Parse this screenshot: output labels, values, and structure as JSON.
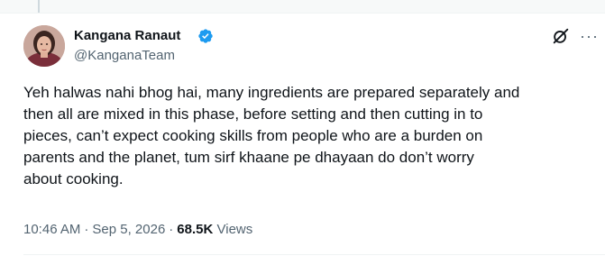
{
  "colors": {
    "primary_text": "#0f1419",
    "secondary_text": "#536471",
    "verified_badge": "#1d9bf0",
    "divider": "#eff3f4"
  },
  "author": {
    "display_name": "Kangana Ranaut",
    "handle": "@KanganaTeam",
    "verified_icon": "verified-badge-icon",
    "avatar_icon": "profile-photo"
  },
  "header_actions": {
    "grok_icon": "grok-slash-icon",
    "more_icon": "more-horizontal-icon"
  },
  "tweet": {
    "text": "Yeh halwas nahi bhog hai, many ingredients are prepared separately and\nthen all are mixed in this phase, before setting and then cutting in to\npieces, can’t expect cooking skills from people who are a burden on\nparents and the planet, tum sirf khaane pe dhayaan do don’t worry\nabout cooking.",
    "time": "10:46 AM",
    "separator": "·",
    "date": "Sep 5, 2026",
    "views_count": "68.5K",
    "views_label": "Views"
  }
}
